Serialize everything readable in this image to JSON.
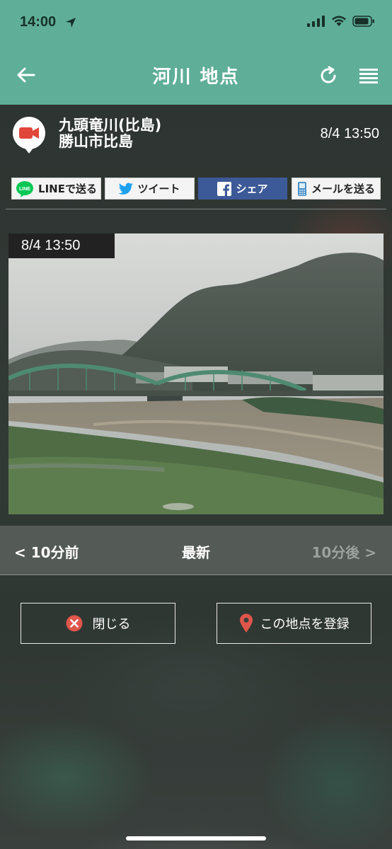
{
  "status_bar": {
    "time": "14:00"
  },
  "navbar": {
    "title": "河川 地点"
  },
  "location": {
    "name_line1": "九頭竜川(比島)",
    "name_line2": "勝山市比島",
    "datetime": "8/4 13:50"
  },
  "share": {
    "line": "LINEで送る",
    "line_logo": "LINE",
    "tweet": "ツイート",
    "facebook": "シェア",
    "mail": "メールを送る"
  },
  "camera": {
    "timestamp": "8/4 13:50"
  },
  "time_nav": {
    "prev": "< 10分前",
    "latest": "最新",
    "next": "10分後 >"
  },
  "actions": {
    "close": "閉じる",
    "register": "この地点を登録"
  },
  "colors": {
    "accent": "#5fae98",
    "camera_icon": "#e0463a",
    "facebook": "#3d5a98",
    "line": "#06c755",
    "twitter": "#1da1f2"
  }
}
